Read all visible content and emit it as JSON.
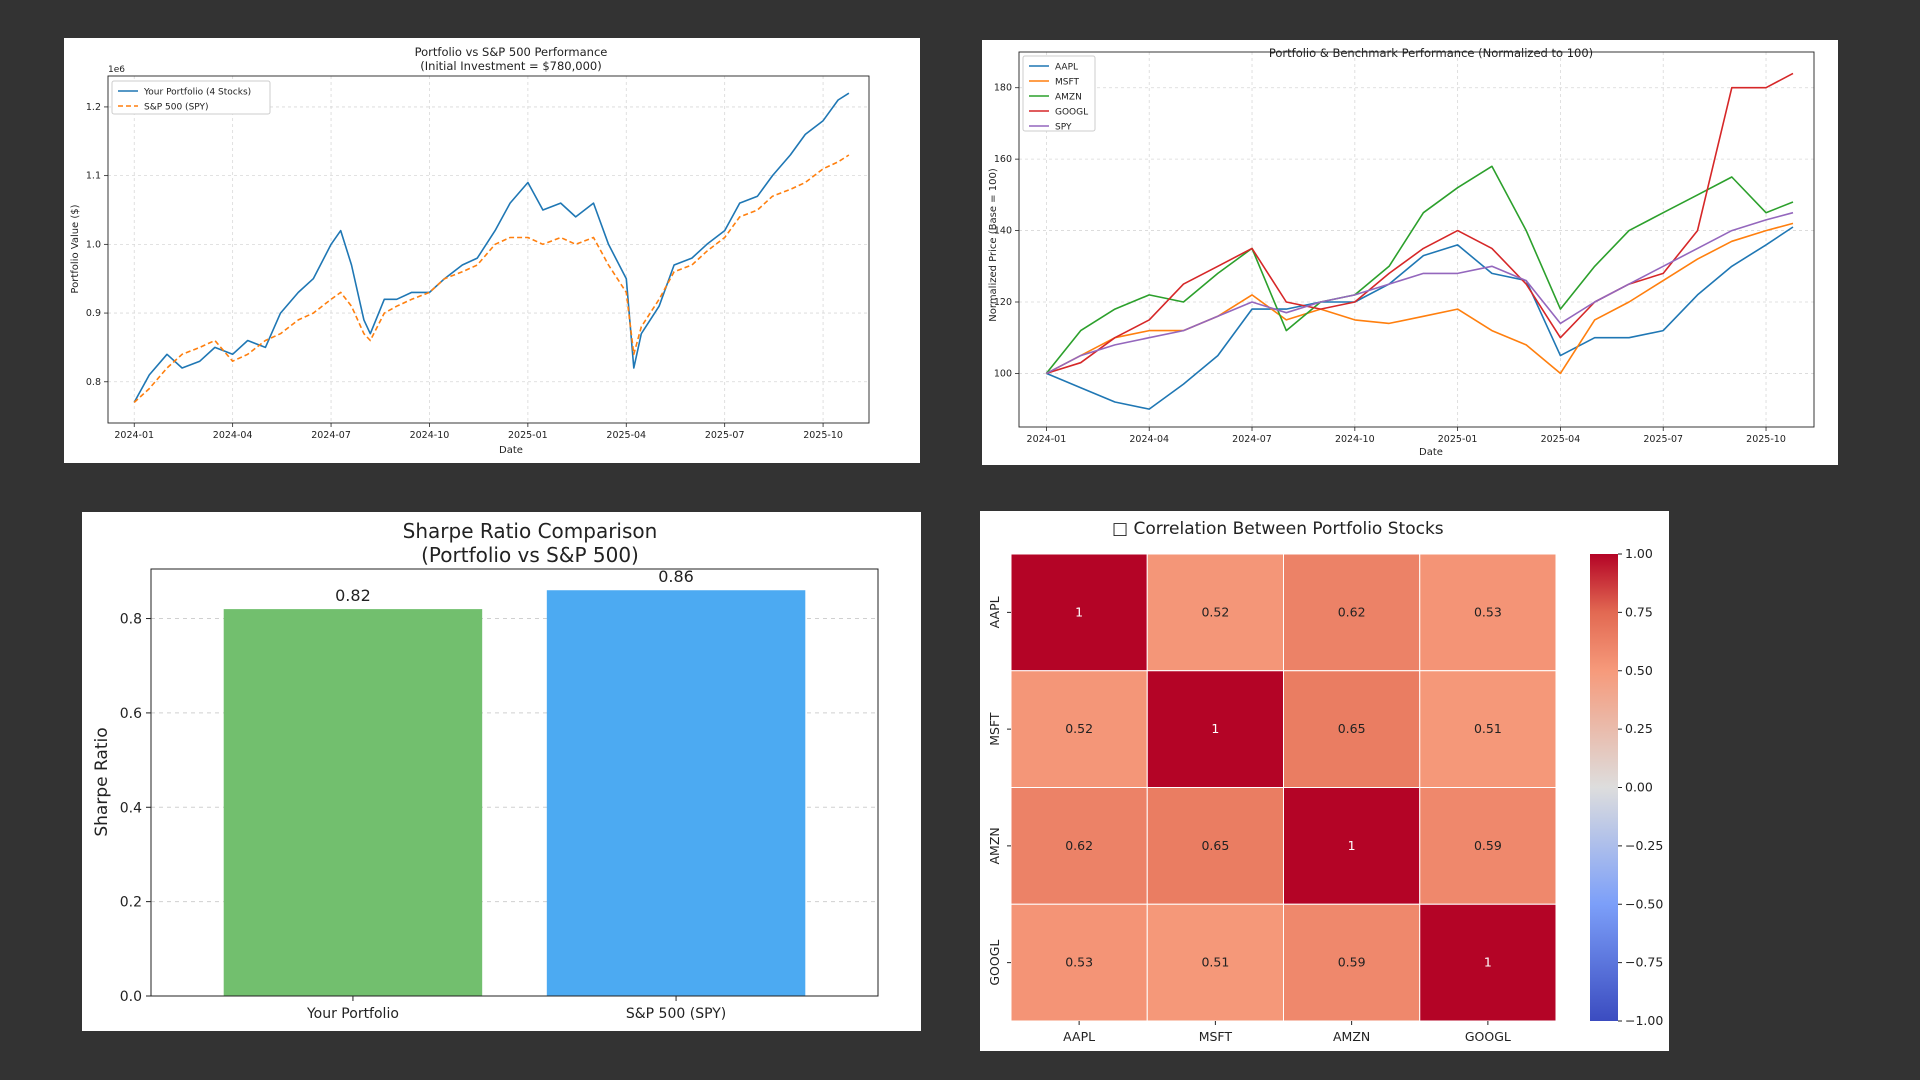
{
  "colors": {
    "background": "#333333",
    "portfolio_line": "#1f77b4",
    "spy_line": "#ff7f0e",
    "aapl": "#1f77b4",
    "msft": "#ff7f0e",
    "amzn": "#2ca02c",
    "googl": "#d62728",
    "spy": "#9467bd",
    "bar_portfolio": "#72bf6e",
    "bar_spy": "#4caaf2"
  },
  "chart_data": [
    {
      "type": "line",
      "title": "Portfolio vs S&P 500 Performance",
      "subtitle": "(Initial Investment = $780,000)",
      "xlabel": "Date",
      "ylabel": "Portfolio Value ($)",
      "y_offset_label": "1e6",
      "x_range": [
        "2024-01",
        "2025-10"
      ],
      "ylim": [
        0.74,
        1.245
      ],
      "yticks": [
        0.8,
        0.9,
        1.0,
        1.1,
        1.2
      ],
      "ytick_labels": [
        "0.8",
        "0.9",
        "1.0",
        "1.1",
        "1.2"
      ],
      "xtick_labels": [
        "2024-01",
        "2024-04",
        "2024-07",
        "2024-10",
        "2025-01",
        "2025-04",
        "2025-07",
        "2025-10"
      ],
      "grid": true,
      "legend_position": "top-left",
      "series": [
        {
          "name": "Your Portfolio (4 Stocks)",
          "style": "solid",
          "x": [
            "2024-01-01",
            "2024-01-15",
            "2024-02-01",
            "2024-02-15",
            "2024-03-01",
            "2024-03-15",
            "2024-04-01",
            "2024-04-15",
            "2024-05-01",
            "2024-05-15",
            "2024-06-01",
            "2024-06-15",
            "2024-07-01",
            "2024-07-10",
            "2024-07-20",
            "2024-08-01",
            "2024-08-07",
            "2024-08-20",
            "2024-09-01",
            "2024-09-15",
            "2024-10-01",
            "2024-10-15",
            "2024-11-01",
            "2024-11-15",
            "2024-12-01",
            "2024-12-15",
            "2025-01-01",
            "2025-01-15",
            "2025-02-01",
            "2025-02-15",
            "2025-03-01",
            "2025-03-15",
            "2025-04-01",
            "2025-04-08",
            "2025-04-15",
            "2025-05-01",
            "2025-05-15",
            "2025-06-01",
            "2025-06-15",
            "2025-07-01",
            "2025-07-15",
            "2025-08-01",
            "2025-08-15",
            "2025-09-01",
            "2025-09-15",
            "2025-10-01",
            "2025-10-15",
            "2025-10-25"
          ],
          "values": [
            0.77,
            0.81,
            0.84,
            0.82,
            0.83,
            0.85,
            0.84,
            0.86,
            0.85,
            0.9,
            0.93,
            0.95,
            1.0,
            1.02,
            0.97,
            0.89,
            0.87,
            0.92,
            0.92,
            0.93,
            0.93,
            0.95,
            0.97,
            0.98,
            1.02,
            1.06,
            1.09,
            1.05,
            1.06,
            1.04,
            1.06,
            1.0,
            0.95,
            0.82,
            0.87,
            0.91,
            0.97,
            0.98,
            1.0,
            1.02,
            1.06,
            1.07,
            1.1,
            1.13,
            1.16,
            1.18,
            1.21,
            1.22
          ]
        },
        {
          "name": "S&P 500 (SPY)",
          "style": "dashed",
          "x": [
            "2024-01-01",
            "2024-01-15",
            "2024-02-01",
            "2024-02-15",
            "2024-03-01",
            "2024-03-15",
            "2024-04-01",
            "2024-04-15",
            "2024-05-01",
            "2024-05-15",
            "2024-06-01",
            "2024-06-15",
            "2024-07-01",
            "2024-07-10",
            "2024-07-20",
            "2024-08-01",
            "2024-08-07",
            "2024-08-20",
            "2024-09-01",
            "2024-09-15",
            "2024-10-01",
            "2024-10-15",
            "2024-11-01",
            "2024-11-15",
            "2024-12-01",
            "2024-12-15",
            "2025-01-01",
            "2025-01-15",
            "2025-02-01",
            "2025-02-15",
            "2025-03-01",
            "2025-03-15",
            "2025-04-01",
            "2025-04-08",
            "2025-04-15",
            "2025-05-01",
            "2025-05-15",
            "2025-06-01",
            "2025-06-15",
            "2025-07-01",
            "2025-07-15",
            "2025-08-01",
            "2025-08-15",
            "2025-09-01",
            "2025-09-15",
            "2025-10-01",
            "2025-10-15",
            "2025-10-25"
          ],
          "values": [
            0.77,
            0.79,
            0.82,
            0.84,
            0.85,
            0.86,
            0.83,
            0.84,
            0.86,
            0.87,
            0.89,
            0.9,
            0.92,
            0.93,
            0.91,
            0.87,
            0.86,
            0.9,
            0.91,
            0.92,
            0.93,
            0.95,
            0.96,
            0.97,
            1.0,
            1.01,
            1.01,
            1.0,
            1.01,
            1.0,
            1.01,
            0.97,
            0.93,
            0.84,
            0.88,
            0.92,
            0.96,
            0.97,
            0.99,
            1.01,
            1.04,
            1.05,
            1.07,
            1.08,
            1.09,
            1.11,
            1.12,
            1.13
          ]
        }
      ]
    },
    {
      "type": "line",
      "title": "Portfolio & Benchmark Performance (Normalized to 100)",
      "xlabel": "Date",
      "ylabel": "Normalized Price (Base = 100)",
      "x_range": [
        "2024-01",
        "2025-10"
      ],
      "ylim": [
        85,
        190
      ],
      "yticks": [
        100,
        120,
        140,
        160,
        180
      ],
      "ytick_labels": [
        "100",
        "120",
        "140",
        "160",
        "180"
      ],
      "xtick_labels": [
        "2024-01",
        "2024-04",
        "2024-07",
        "2024-10",
        "2025-01",
        "2025-04",
        "2025-07",
        "2025-10"
      ],
      "grid": true,
      "legend_position": "top-left",
      "series": [
        {
          "name": "AAPL",
          "x": [
            "2024-01-01",
            "2024-02-01",
            "2024-03-01",
            "2024-04-01",
            "2024-05-01",
            "2024-06-01",
            "2024-07-01",
            "2024-08-01",
            "2024-09-01",
            "2024-10-01",
            "2024-11-01",
            "2024-12-01",
            "2025-01-01",
            "2025-02-01",
            "2025-03-01",
            "2025-04-01",
            "2025-05-01",
            "2025-06-01",
            "2025-07-01",
            "2025-08-01",
            "2025-09-01",
            "2025-10-01",
            "2025-10-25"
          ],
          "values": [
            100,
            96,
            92,
            90,
            97,
            105,
            118,
            118,
            120,
            120,
            125,
            133,
            136,
            128,
            126,
            105,
            110,
            110,
            112,
            122,
            130,
            136,
            141
          ]
        },
        {
          "name": "MSFT",
          "x": [
            "2024-01-01",
            "2024-02-01",
            "2024-03-01",
            "2024-04-01",
            "2024-05-01",
            "2024-06-01",
            "2024-07-01",
            "2024-08-01",
            "2024-09-01",
            "2024-10-01",
            "2024-11-01",
            "2024-12-01",
            "2025-01-01",
            "2025-02-01",
            "2025-03-01",
            "2025-04-01",
            "2025-05-01",
            "2025-06-01",
            "2025-07-01",
            "2025-08-01",
            "2025-09-01",
            "2025-10-01",
            "2025-10-25"
          ],
          "values": [
            100,
            105,
            110,
            112,
            112,
            116,
            122,
            115,
            118,
            115,
            114,
            116,
            118,
            112,
            108,
            100,
            115,
            120,
            126,
            132,
            137,
            140,
            142
          ]
        },
        {
          "name": "AMZN",
          "x": [
            "2024-01-01",
            "2024-02-01",
            "2024-03-01",
            "2024-04-01",
            "2024-05-01",
            "2024-06-01",
            "2024-07-01",
            "2024-08-01",
            "2024-09-01",
            "2024-10-01",
            "2024-11-01",
            "2024-12-01",
            "2025-01-01",
            "2025-02-01",
            "2025-03-01",
            "2025-04-01",
            "2025-05-01",
            "2025-06-01",
            "2025-07-01",
            "2025-08-01",
            "2025-09-01",
            "2025-10-01",
            "2025-10-25"
          ],
          "values": [
            100,
            112,
            118,
            122,
            120,
            128,
            135,
            112,
            120,
            122,
            130,
            145,
            152,
            158,
            140,
            118,
            130,
            140,
            145,
            150,
            155,
            145,
            148
          ]
        },
        {
          "name": "GOOGL",
          "x": [
            "2024-01-01",
            "2024-02-01",
            "2024-03-01",
            "2024-04-01",
            "2024-05-01",
            "2024-06-01",
            "2024-07-01",
            "2024-08-01",
            "2024-09-01",
            "2024-10-01",
            "2024-11-01",
            "2024-12-01",
            "2025-01-01",
            "2025-02-01",
            "2025-03-01",
            "2025-04-01",
            "2025-05-01",
            "2025-06-01",
            "2025-07-01",
            "2025-08-01",
            "2025-09-01",
            "2025-10-01",
            "2025-10-25"
          ],
          "values": [
            100,
            103,
            110,
            115,
            125,
            130,
            135,
            120,
            118,
            120,
            128,
            135,
            140,
            135,
            125,
            110,
            120,
            125,
            128,
            140,
            180,
            180,
            184
          ]
        },
        {
          "name": "SPY",
          "x": [
            "2024-01-01",
            "2024-02-01",
            "2024-03-01",
            "2024-04-01",
            "2024-05-01",
            "2024-06-01",
            "2024-07-01",
            "2024-08-01",
            "2024-09-01",
            "2024-10-01",
            "2024-11-01",
            "2024-12-01",
            "2025-01-01",
            "2025-02-01",
            "2025-03-01",
            "2025-04-01",
            "2025-05-01",
            "2025-06-01",
            "2025-07-01",
            "2025-08-01",
            "2025-09-01",
            "2025-10-01",
            "2025-10-25"
          ],
          "values": [
            100,
            105,
            108,
            110,
            112,
            116,
            120,
            117,
            120,
            122,
            125,
            128,
            128,
            130,
            126,
            114,
            120,
            125,
            130,
            135,
            140,
            143,
            145
          ]
        }
      ]
    },
    {
      "type": "bar",
      "title": "Sharpe Ratio Comparison",
      "subtitle": "(Portfolio vs S&P 500)",
      "xlabel": "",
      "ylabel": "Sharpe Ratio",
      "categories": [
        "Your Portfolio",
        "S&P 500 (SPY)"
      ],
      "values": [
        0.82,
        0.86
      ],
      "value_labels": [
        "0.82",
        "0.86"
      ],
      "ylim": [
        0,
        0.905
      ],
      "yticks": [
        0.0,
        0.2,
        0.4,
        0.6,
        0.8
      ],
      "ytick_labels": [
        "0.0",
        "0.2",
        "0.4",
        "0.6",
        "0.8"
      ],
      "grid": true
    },
    {
      "type": "heatmap",
      "title": "□ Correlation Between Portfolio Stocks",
      "row_labels": [
        "AAPL",
        "MSFT",
        "AMZN",
        "GOOGL"
      ],
      "col_labels": [
        "AAPL",
        "MSFT",
        "AMZN",
        "GOOGL"
      ],
      "values": [
        [
          1.0,
          0.52,
          0.62,
          0.53
        ],
        [
          0.52,
          1.0,
          0.65,
          0.51
        ],
        [
          0.62,
          0.65,
          1.0,
          0.59
        ],
        [
          0.53,
          0.51,
          0.59,
          1.0
        ]
      ],
      "cell_labels": [
        [
          "1",
          "0.52",
          "0.62",
          "0.53"
        ],
        [
          "0.52",
          "1",
          "0.65",
          "0.51"
        ],
        [
          "0.62",
          "0.65",
          "1",
          "0.59"
        ],
        [
          "0.53",
          "0.51",
          "0.59",
          "1"
        ]
      ],
      "colorscale": "coolwarm",
      "vmin": -1.0,
      "vmax": 1.0,
      "colorbar_ticks": [
        1.0,
        0.75,
        0.5,
        0.25,
        0.0,
        -0.25,
        -0.5,
        -0.75,
        -1.0
      ],
      "colorbar_tick_labels": [
        "1.00",
        "0.75",
        "0.50",
        "0.25",
        "0.00",
        "−0.25",
        "−0.50",
        "−0.75",
        "−1.00"
      ]
    }
  ]
}
